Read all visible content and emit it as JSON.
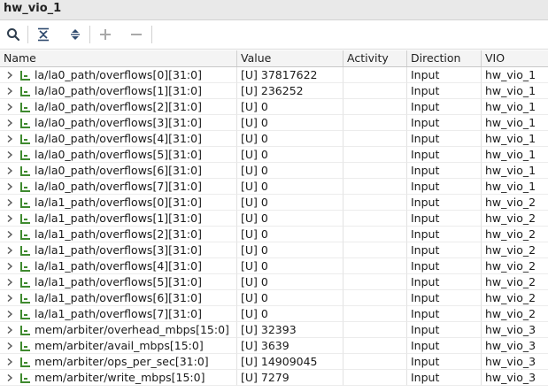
{
  "window": {
    "title": "hw_vio_1"
  },
  "toolbar": {
    "icons": [
      "search-icon",
      "collapse-all-icon",
      "expand-all-icon",
      "add-icon",
      "remove-icon"
    ]
  },
  "columns": {
    "name": "Name",
    "value": "Value",
    "activity": "Activity",
    "direction": "Direction",
    "vio": "VIO"
  },
  "colors": {
    "signal_icon": "#3f8a2f",
    "header_bg": "#f4f4f4",
    "title_bg": "#e9e9e9"
  },
  "rows": [
    {
      "name": "la/la0_path/overflows[0][31:0]",
      "value": "[U] 37817622",
      "activity": "",
      "direction": "Input",
      "vio": "hw_vio_1"
    },
    {
      "name": "la/la0_path/overflows[1][31:0]",
      "value": "[U] 236252",
      "activity": "",
      "direction": "Input",
      "vio": "hw_vio_1"
    },
    {
      "name": "la/la0_path/overflows[2][31:0]",
      "value": "[U] 0",
      "activity": "",
      "direction": "Input",
      "vio": "hw_vio_1"
    },
    {
      "name": "la/la0_path/overflows[3][31:0]",
      "value": "[U] 0",
      "activity": "",
      "direction": "Input",
      "vio": "hw_vio_1"
    },
    {
      "name": "la/la0_path/overflows[4][31:0]",
      "value": "[U] 0",
      "activity": "",
      "direction": "Input",
      "vio": "hw_vio_1"
    },
    {
      "name": "la/la0_path/overflows[5][31:0]",
      "value": "[U] 0",
      "activity": "",
      "direction": "Input",
      "vio": "hw_vio_1"
    },
    {
      "name": "la/la0_path/overflows[6][31:0]",
      "value": "[U] 0",
      "activity": "",
      "direction": "Input",
      "vio": "hw_vio_1"
    },
    {
      "name": "la/la0_path/overflows[7][31:0]",
      "value": "[U] 0",
      "activity": "",
      "direction": "Input",
      "vio": "hw_vio_1"
    },
    {
      "name": "la/la1_path/overflows[0][31:0]",
      "value": "[U] 0",
      "activity": "",
      "direction": "Input",
      "vio": "hw_vio_2"
    },
    {
      "name": "la/la1_path/overflows[1][31:0]",
      "value": "[U] 0",
      "activity": "",
      "direction": "Input",
      "vio": "hw_vio_2"
    },
    {
      "name": "la/la1_path/overflows[2][31:0]",
      "value": "[U] 0",
      "activity": "",
      "direction": "Input",
      "vio": "hw_vio_2"
    },
    {
      "name": "la/la1_path/overflows[3][31:0]",
      "value": "[U] 0",
      "activity": "",
      "direction": "Input",
      "vio": "hw_vio_2"
    },
    {
      "name": "la/la1_path/overflows[4][31:0]",
      "value": "[U] 0",
      "activity": "",
      "direction": "Input",
      "vio": "hw_vio_2"
    },
    {
      "name": "la/la1_path/overflows[5][31:0]",
      "value": "[U] 0",
      "activity": "",
      "direction": "Input",
      "vio": "hw_vio_2"
    },
    {
      "name": "la/la1_path/overflows[6][31:0]",
      "value": "[U] 0",
      "activity": "",
      "direction": "Input",
      "vio": "hw_vio_2"
    },
    {
      "name": "la/la1_path/overflows[7][31:0]",
      "value": "[U] 0",
      "activity": "",
      "direction": "Input",
      "vio": "hw_vio_2"
    },
    {
      "name": "mem/arbiter/overhead_mbps[15:0]",
      "value": "[U] 32393",
      "activity": "",
      "direction": "Input",
      "vio": "hw_vio_3"
    },
    {
      "name": "mem/arbiter/avail_mbps[15:0]",
      "value": "[U] 3639",
      "activity": "",
      "direction": "Input",
      "vio": "hw_vio_3"
    },
    {
      "name": "mem/arbiter/ops_per_sec[31:0]",
      "value": "[U] 14909045",
      "activity": "",
      "direction": "Input",
      "vio": "hw_vio_3"
    },
    {
      "name": "mem/arbiter/write_mbps[15:0]",
      "value": "[U] 7279",
      "activity": "",
      "direction": "Input",
      "vio": "hw_vio_3"
    }
  ]
}
